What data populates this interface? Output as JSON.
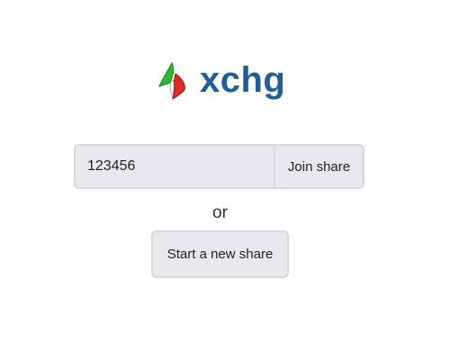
{
  "brand": {
    "name": "xchg",
    "color": "#1e5f98",
    "icon": "xchg-logo-icon",
    "icon_colors": [
      "#2db82d",
      "#e02a2a"
    ]
  },
  "join": {
    "input_value": "123456",
    "button_label": "Join share"
  },
  "separator": "or",
  "new_share": {
    "button_label": "Start a new share"
  }
}
